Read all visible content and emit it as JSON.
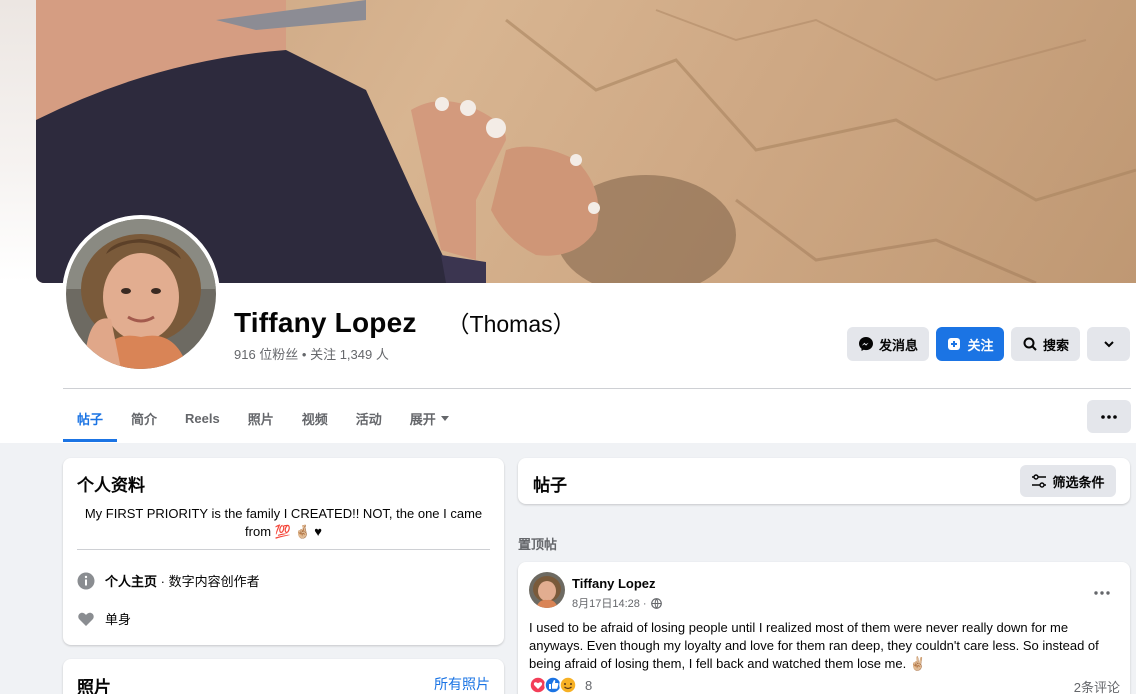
{
  "profile": {
    "name": "Tiffany Lopez",
    "alternate_name": "（Thomas）",
    "followers_text": "916 位粉丝 • 关注 1,349 人"
  },
  "actions": {
    "message_label": "发消息",
    "follow_label": "关注",
    "search_label": "搜索"
  },
  "tabs": [
    {
      "label": "帖子",
      "active": true
    },
    {
      "label": "简介"
    },
    {
      "label": "Reels"
    },
    {
      "label": "照片"
    },
    {
      "label": "视频"
    },
    {
      "label": "活动"
    },
    {
      "label": "展开"
    }
  ],
  "intro": {
    "title": "个人资料",
    "bio": "My FIRST PRIORITY is the family I CREATED!! NOT, the one I came from 💯 🤞🏼 ♥",
    "page_type_prefix": "个人主页",
    "page_type": " · 数字内容创作者",
    "relationship": "单身"
  },
  "photos": {
    "title": "照片",
    "all_link": "所有照片"
  },
  "posts_header": {
    "title": "帖子",
    "filter_label": "筛选条件"
  },
  "pinned_label": "置顶帖",
  "post": {
    "author": "Tiffany Lopez",
    "time": "8月17日14:28 ·",
    "text": "I used to be afraid of losing people until I realized most of them were never really down for me anyways. Even though my loyalty and love for them ran deep, they couldn't care less. So instead of being afraid of losing them, I fell back and watched them lose me. ✌🏼",
    "reaction_count": "8",
    "comments": "2条评论"
  },
  "colors": {
    "accent": "#1b74e4",
    "secondary_text": "#65676b",
    "button_grey": "#e4e6eb",
    "page_bg": "#f0f2f5"
  },
  "icons": {
    "message": "messenger-icon",
    "follow": "follow-plus-icon",
    "search": "search-icon",
    "dropdown": "chevron-down-icon",
    "more": "more-dots-icon",
    "info": "info-icon",
    "heart": "heart-icon",
    "filter": "filter-sliders-icon",
    "globe": "globe-icon"
  }
}
